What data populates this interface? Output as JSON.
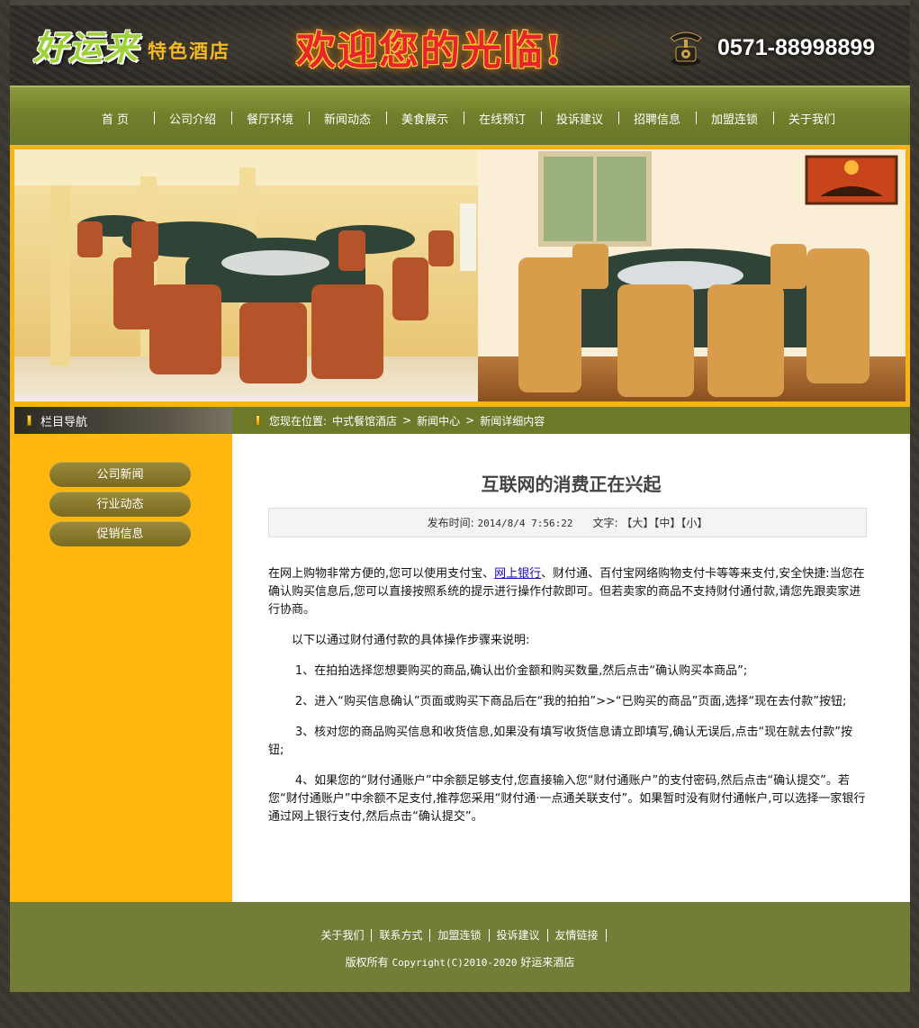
{
  "header": {
    "logo_main": "好运来",
    "logo_sub": "特色酒店",
    "welcome": "欢迎您的光临!",
    "phone": "0571-88998899"
  },
  "nav": {
    "items": [
      "首 页",
      "公司介绍",
      "餐厅环境",
      "新闻动态",
      "美食展示",
      "在线预订",
      "投诉建议",
      "招聘信息",
      "加盟连锁",
      "关于我们"
    ]
  },
  "sidebar": {
    "title": "栏目导航",
    "items": [
      "公司新闻",
      "行业动态",
      "促销信息"
    ]
  },
  "breadcrumb": {
    "prefix": "您现在位置:",
    "items": [
      "中式餐馆酒店",
      "新闻中心",
      "新闻详细内容"
    ]
  },
  "article": {
    "title": "互联网的消费正在兴起",
    "publish_label": "发布时间:",
    "publish_time": "2014/8/4 7:56:22",
    "size_label": "文字:",
    "size_large": "【大】",
    "size_medium": "【中】",
    "size_small": "【小】",
    "p1_before": "在网上购物非常方便的,您可以使用支付宝、",
    "p1_link": "网上银行",
    "p1_after": "、财付通、百付宝网络购物支付卡等等来支付,安全快捷:当您在确认购买信息后,您可以直接按照系统的提示进行操作付款即可。但若卖家的商品不支持财付通付款,请您先跟卖家进行协商。",
    "p2": "以下以通过财付通付款的具体操作步骤来说明:",
    "p3": "1、在拍拍选择您想要购买的商品,确认出价金额和购买数量,然后点击“确认购买本商品”;",
    "p4": "2、进入“购买信息确认”页面或购买下商品后在“我的拍拍”>>“已购买的商品”页面,选择“现在去付款”按钮;",
    "p5": "3、核对您的商品购买信息和收货信息,如果没有填写收货信息请立即填写,确认无误后,点击“现在就去付款”按钮;",
    "p6": "4、如果您的“财付通账户”中余额足够支付,您直接输入您“财付通账户”的支付密码,然后点击“确认提交”。若您“财付通账户”中余额不足支付,推荐您采用“财付通·一点通关联支付”。如果暂时没有财付通帐户,可以选择一家银行通过网上银行支付,然后点击“确认提交”。"
  },
  "footer": {
    "links": [
      "关于我们",
      "联系方式",
      "加盟连锁",
      "投诉建议",
      "友情链接"
    ],
    "copyright_prefix": "版权所有",
    "copyright_code": "Copyright(C)2010-2020",
    "copyright_name": "好运来酒店"
  },
  "colors": {
    "nav_green": "#6f7f2a",
    "sidebar_yellow": "#ffb60f",
    "footer_green": "#737d38",
    "frame_dark": "#3a3630"
  }
}
